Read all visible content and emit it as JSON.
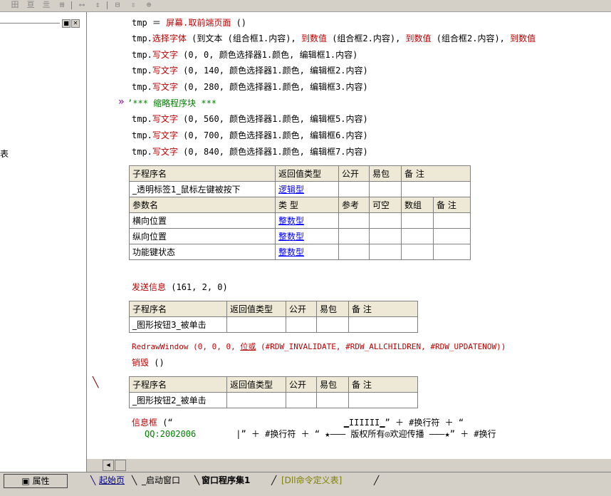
{
  "left_panel": {
    "fragment": "表",
    "prop_label": "属性"
  },
  "tabs": [
    {
      "label": "起始页",
      "color": "#000080"
    },
    {
      "label": "_启动窗口",
      "color": "#000000"
    },
    {
      "label": "窗口程序集1",
      "color": "#000000"
    },
    {
      "label": "[Dll命令定义表]",
      "color": "#808000"
    }
  ],
  "code": {
    "line1_a": "tmp ＝ ",
    "line1_b": "屏幕.取前端页面",
    "line1_c": " ()",
    "line2_a": "tmp.",
    "line2_b": "选择字体",
    "line2_c": " (到文本 (组合框1.内容), ",
    "line2_d": "到数值",
    "line2_e": " (组合框2.内容), ",
    "line2_f": "到数值",
    "line2_g": " (组合框2.内容), ",
    "line2_h": "到数值",
    "write_text_1": [
      "tmp.",
      "写文字",
      " (0, 0, 颜色选择器1.颜色, 编辑框1.内容)"
    ],
    "write_text_2": [
      "tmp.",
      "写文字",
      " (0, 140, 颜色选择器1.颜色, 编辑框2.内容)"
    ],
    "write_text_3": [
      "tmp.",
      "写文字",
      " (0, 280, 颜色选择器1.颜色, 编辑框3.内容)"
    ],
    "collapsed": "’*** 缩略程序块 ***",
    "write_text_5": [
      "tmp.",
      "写文字",
      " (0, 560, 颜色选择器1.颜色, 编辑框5.内容)"
    ],
    "write_text_6": [
      "tmp.",
      "写文字",
      " (0, 700, 颜色选择器1.颜色, 编辑框6.内容)"
    ],
    "write_text_7": [
      "tmp.",
      "写文字",
      " (0, 840, 颜色选择器1.颜色, 编辑框7.内容)"
    ],
    "send_msg_a": "发送信息",
    "send_msg_b": " (161, 2, 0)",
    "redraw_a": "RedrawWindow (0, 0, 0, ",
    "redraw_b": "位或",
    "redraw_c": " (#RDW_INVALIDATE, #RDW_ALLCHILDREN, #RDW_UPDATENOW))",
    "destroy_a": "销毁",
    "destroy_b": " ()",
    "msgbox_a": "信息框",
    "msgbox_b": " (“",
    "msgbox_c": "▁IIIIII▁",
    "msgbox_d": "” ＋ #换行符 ＋ “",
    "msgbox_line2_a": "QQ:2002006",
    "msgbox_line2_b": "|” ＋ #换行符 ＋ “ ★——— 版权所有◎欢迎传播 ———★” ＋ #换行"
  },
  "table1": {
    "headers": [
      "子程序名",
      "返回值类型",
      "公开",
      "易包",
      "备 注"
    ],
    "sub_name": "_透明标签1_鼠标左键被按下",
    "return_type": "逻辑型",
    "param_headers": [
      "参数名",
      "类 型",
      "参考",
      "可空",
      "数组",
      "备 注"
    ],
    "params": [
      {
        "name": "横向位置",
        "type": "整数型"
      },
      {
        "name": "纵向位置",
        "type": "整数型"
      },
      {
        "name": "功能键状态",
        "type": "整数型"
      }
    ]
  },
  "table2": {
    "headers": [
      "子程序名",
      "返回值类型",
      "公开",
      "易包",
      "备 注"
    ],
    "sub_name": "_图形按钮3_被单击"
  },
  "table3": {
    "headers": [
      "子程序名",
      "返回值类型",
      "公开",
      "易包",
      "备 注"
    ],
    "sub_name": "_图形按钮2_被单击"
  }
}
